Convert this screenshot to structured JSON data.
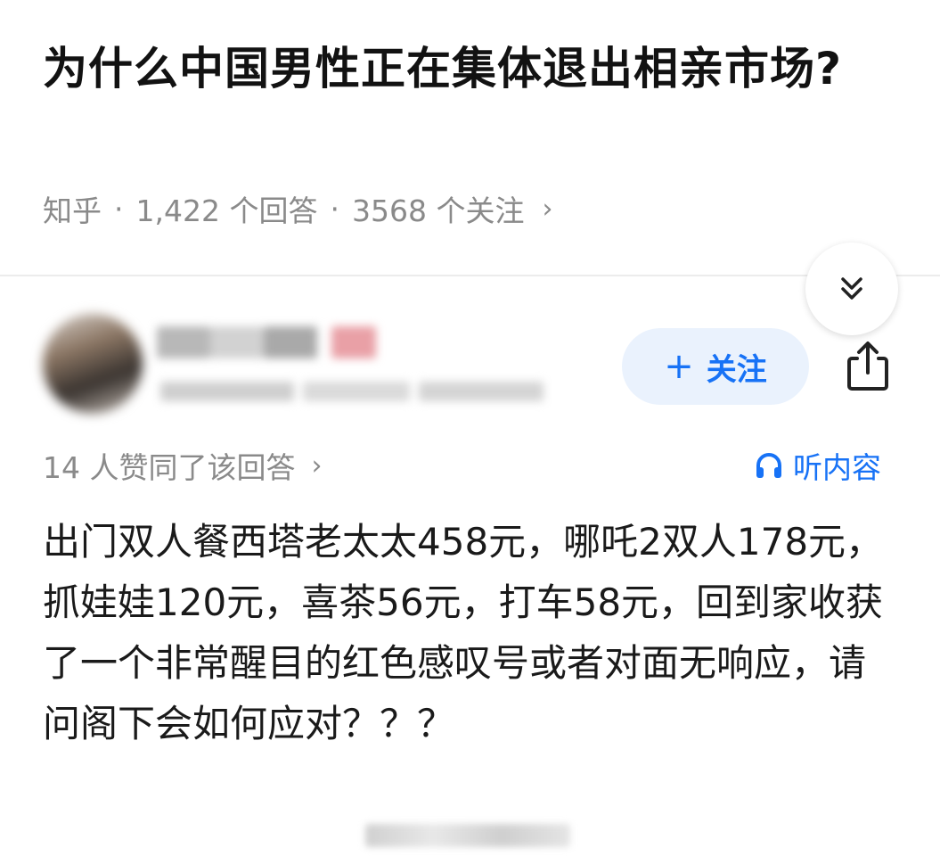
{
  "question": {
    "title": "为什么中国男性正在集体退出相亲市场?"
  },
  "meta": {
    "source": "知乎",
    "separator": "·",
    "answers": "1,422 个回答",
    "followers": "3568 个关注",
    "chevron": "›"
  },
  "toolbar": {
    "collapse_icon": "double-chevron-down-icon",
    "share_icon": "share-icon"
  },
  "author": {
    "follow_plus": "+",
    "follow_label": "关注"
  },
  "answer": {
    "upvotes": "14 人赞同了该回答",
    "upvotes_chevron": "›",
    "listen_label": "听内容",
    "body": "出门双人餐西塔老太太458元，哪吒2双人178元，抓娃娃120元，喜茶56元，打车58元，回到家收获了一个非常醒目的红色感叹号或者对面无响应，请问阁下会如何应对？？？"
  },
  "colors": {
    "accent": "#1772f6",
    "accent_bg": "#eaf2fd",
    "meta_gray": "#8a8a8a",
    "text": "#1a1a1a"
  }
}
